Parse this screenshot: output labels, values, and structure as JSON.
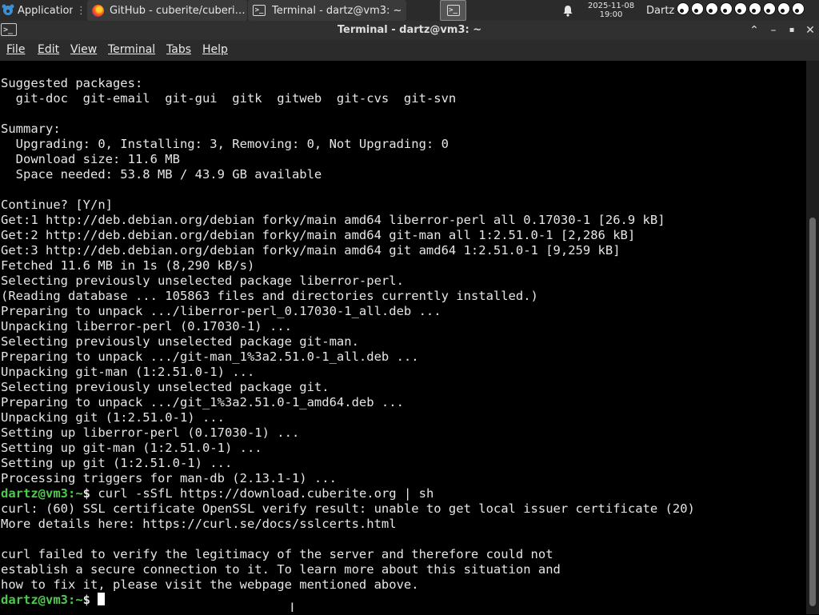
{
  "panel": {
    "applications_label": "Applications",
    "tasks": [
      {
        "label": "GitHub - cuberite/cuberi…",
        "icon": "firefox-icon"
      },
      {
        "label": "Terminal - dartz@vm3: ~",
        "icon": "terminal-icon"
      }
    ],
    "clock_date": "2025-11-08",
    "clock_time": "19:00",
    "user": "Dartz",
    "eye_count": 9
  },
  "window": {
    "title": "Terminal - dartz@vm3: ~"
  },
  "menu": {
    "items": [
      "File",
      "Edit",
      "View",
      "Terminal",
      "Tabs",
      "Help"
    ]
  },
  "terminal": {
    "prompt_user": "dartz@vm3",
    "prompt_suffix": ":~$ ",
    "lines": [
      {
        "text": "Suggested packages:"
      },
      {
        "text": "  git-doc  git-email  git-gui  gitk  gitweb  git-cvs  git-svn"
      },
      {
        "text": ""
      },
      {
        "text": "Summary:"
      },
      {
        "text": "  Upgrading: 0, Installing: 3, Removing: 0, Not Upgrading: 0"
      },
      {
        "text": "  Download size: 11.6 MB"
      },
      {
        "text": "  Space needed: 53.8 MB / 43.9 GB available"
      },
      {
        "text": ""
      },
      {
        "text": "Continue? [Y/n]"
      },
      {
        "text": "Get:1 http://deb.debian.org/debian forky/main amd64 liberror-perl all 0.17030-1 [26.9 kB]"
      },
      {
        "text": "Get:2 http://deb.debian.org/debian forky/main amd64 git-man all 1:2.51.0-1 [2,286 kB]"
      },
      {
        "text": "Get:3 http://deb.debian.org/debian forky/main amd64 git amd64 1:2.51.0-1 [9,259 kB]"
      },
      {
        "text": "Fetched 11.6 MB in 1s (8,290 kB/s)"
      },
      {
        "text": "Selecting previously unselected package liberror-perl."
      },
      {
        "text": "(Reading database ... 105863 files and directories currently installed.)"
      },
      {
        "text": "Preparing to unpack .../liberror-perl_0.17030-1_all.deb ..."
      },
      {
        "text": "Unpacking liberror-perl (0.17030-1) ..."
      },
      {
        "text": "Selecting previously unselected package git-man."
      },
      {
        "text": "Preparing to unpack .../git-man_1%3a2.51.0-1_all.deb ..."
      },
      {
        "text": "Unpacking git-man (1:2.51.0-1) ..."
      },
      {
        "text": "Selecting previously unselected package git."
      },
      {
        "text": "Preparing to unpack .../git_1%3a2.51.0-1_amd64.deb ..."
      },
      {
        "text": "Unpacking git (1:2.51.0-1) ..."
      },
      {
        "text": "Setting up liberror-perl (0.17030-1) ..."
      },
      {
        "text": "Setting up git-man (1:2.51.0-1) ..."
      },
      {
        "text": "Setting up git (1:2.51.0-1) ..."
      },
      {
        "text": "Processing triggers for man-db (2.13.1-1) ..."
      },
      {
        "prompt": true,
        "text": "curl -sSfL https://download.cuberite.org | sh"
      },
      {
        "text": "curl: (60) SSL certificate OpenSSL verify result: unable to get local issuer certificate (20)"
      },
      {
        "text": "More details here: https://curl.se/docs/sslcerts.html"
      },
      {
        "text": ""
      },
      {
        "text": "curl failed to verify the legitimacy of the server and therefore could not"
      },
      {
        "text": "establish a secure connection to it. To learn more about this situation and"
      },
      {
        "text": "how to fix it, please visit the webpage mentioned above."
      },
      {
        "prompt": true,
        "text": "",
        "cursor": true
      }
    ]
  },
  "colors": {
    "prompt_green": "#4ec94e",
    "terminal_bg": "#000000",
    "terminal_fg": "#e6e6e6",
    "panel_bg": "#2b2b2b"
  }
}
